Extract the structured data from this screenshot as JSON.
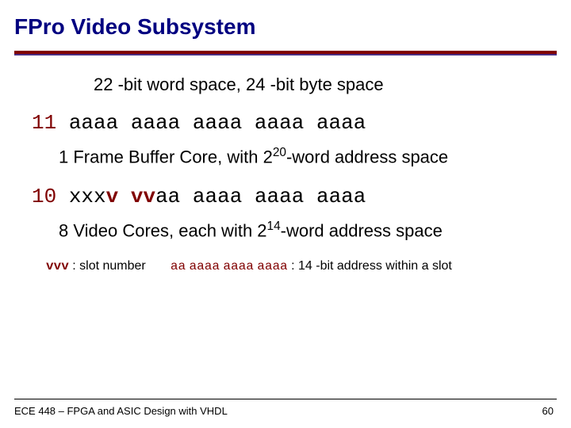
{
  "title": "FPro Video Subsystem",
  "heading": "22 -bit word space, 24 -bit byte space",
  "row1": {
    "prefix": "11",
    "groups": [
      "aaaa",
      "aaaa",
      "aaaa",
      "aaaa",
      "aaaa"
    ]
  },
  "desc1": {
    "pre": "1 Frame Buffer Core, with 2",
    "exp": "20",
    "post": "-word address space"
  },
  "row2": {
    "prefix": "10",
    "g1a": "xxx",
    "g1b": "v",
    "g2a": "vv",
    "g2b": "aa",
    "rest": [
      "aaaa",
      "aaaa",
      "aaaa"
    ]
  },
  "desc2": {
    "pre": "8 Video Cores, each with 2",
    "exp": "14",
    "post": "-word address space"
  },
  "legend": {
    "vvv": "vvv",
    "vvv_desc": " : slot number",
    "aa_groups": [
      "aa",
      "aaaa",
      "aaaa",
      "aaaa"
    ],
    "aa_desc": " : 14 -bit address within a slot"
  },
  "footer": "ECE 448 – FPGA and ASIC Design with VHDL",
  "page": "60"
}
